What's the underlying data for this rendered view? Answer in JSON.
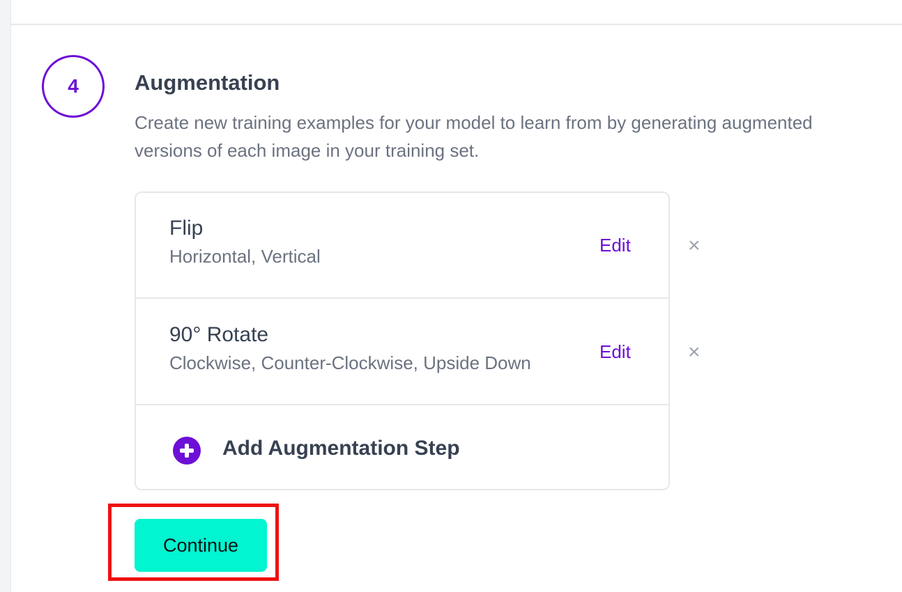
{
  "step": {
    "number": "4",
    "title": "Augmentation",
    "description": "Create new training examples for your model to learn from by generating augmented versions of each image in your training set."
  },
  "augmentations": [
    {
      "name": "Flip",
      "detail": "Horizontal, Vertical",
      "edit_label": "Edit",
      "remove_glyph": "×"
    },
    {
      "name": "90° Rotate",
      "detail": "Clockwise, Counter-Clockwise, Upside Down",
      "edit_label": "Edit",
      "remove_glyph": "×"
    }
  ],
  "add_step": {
    "label": "Add Augmentation Step",
    "icon": "plus-circle-icon"
  },
  "continue_button": {
    "label": "Continue"
  },
  "colors": {
    "accent": "#6d0fd6",
    "continue_bg": "#00f5d0",
    "highlight": "#ee1111"
  }
}
